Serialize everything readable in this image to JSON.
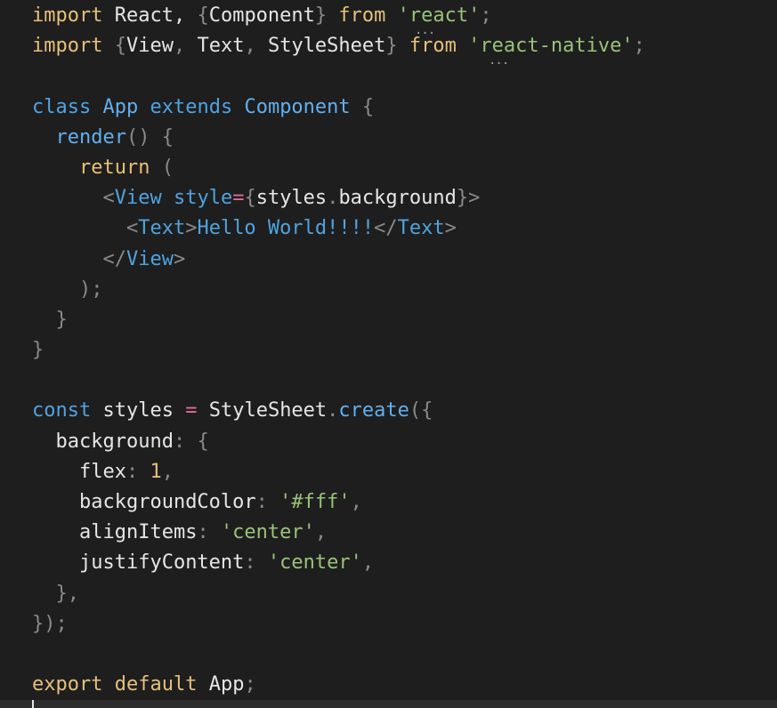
{
  "code_lines": [
    [
      "import",
      " React, ",
      "{",
      "Component",
      "}",
      " from ",
      "'react'",
      ";"
    ],
    [
      "import",
      " ",
      "{",
      "View",
      ", ",
      "Text",
      ", ",
      "StyleSheet",
      "}",
      " from ",
      "'react-native'",
      ";"
    ],
    [],
    [
      "class",
      " ",
      "App",
      " ",
      "extends",
      " ",
      "Component",
      " ",
      "{"
    ],
    [
      "  ",
      "render",
      "()",
      " ",
      "{"
    ],
    [
      "    ",
      "return",
      " ",
      "("
    ],
    [
      "      ",
      "<",
      "View",
      " ",
      "style",
      "=",
      "{",
      "styles",
      ".",
      "background",
      "}",
      ">"
    ],
    [
      "        ",
      "<",
      "Text",
      ">",
      "Hello World!!!!",
      "</",
      "Text",
      ">"
    ],
    [
      "      ",
      "</",
      "View",
      ">"
    ],
    [
      "    ",
      ");"
    ],
    [
      "  ",
      "}"
    ],
    [
      "}"
    ],
    [],
    [
      "const",
      " ",
      "styles",
      " ",
      "=",
      " ",
      "StyleSheet",
      ".",
      "create",
      "({"
    ],
    [
      "  ",
      "background",
      ":",
      " ",
      "{"
    ],
    [
      "    ",
      "flex",
      ":",
      " ",
      "1",
      ","
    ],
    [
      "    ",
      "backgroundColor",
      ":",
      " ",
      "'#fff'",
      ","
    ],
    [
      "    ",
      "alignItems",
      ":",
      " ",
      "'center'",
      ","
    ],
    [
      "    ",
      "justifyContent",
      ":",
      " ",
      "'center'",
      ","
    ],
    [
      "  ",
      "},"
    ],
    [
      "});"
    ],
    [],
    [
      "export",
      " ",
      "default",
      " ",
      "App",
      ";"
    ]
  ],
  "token_types": [
    [
      "kw",
      "id",
      "punc",
      "id",
      "punc",
      "kw",
      "str",
      "punc"
    ],
    [
      "kw",
      "id",
      "punc",
      "id",
      "punc",
      "id",
      "punc",
      "id",
      "punc",
      "kw",
      "str",
      "punc"
    ],
    [],
    [
      "kw2",
      "id",
      "cls",
      "id",
      "kw2",
      "id",
      "cls",
      "id",
      "punc"
    ],
    [
      "id",
      "fn",
      "punc",
      "id",
      "punc"
    ],
    [
      "id",
      "kw",
      "id",
      "punc"
    ],
    [
      "id",
      "punc",
      "tag",
      "id",
      "attr",
      "op",
      "punc",
      "id",
      "punc",
      "prop",
      "punc",
      "punc"
    ],
    [
      "id",
      "punc",
      "tag",
      "punc",
      "text",
      "punc",
      "tag",
      "punc"
    ],
    [
      "id",
      "punc",
      "tag",
      "punc"
    ],
    [
      "id",
      "punc"
    ],
    [
      "id",
      "punc"
    ],
    [
      "punc"
    ],
    [],
    [
      "kw2",
      "id",
      "id",
      "id",
      "op",
      "id",
      "id",
      "punc",
      "fn",
      "punc"
    ],
    [
      "id",
      "prop",
      "punc",
      "id",
      "punc"
    ],
    [
      "id",
      "prop",
      "punc",
      "id",
      "num",
      "punc"
    ],
    [
      "id",
      "prop",
      "punc",
      "id",
      "str",
      "punc"
    ],
    [
      "id",
      "prop",
      "punc",
      "id",
      "str",
      "punc"
    ],
    [
      "id",
      "prop",
      "punc",
      "id",
      "str",
      "punc"
    ],
    [
      "id",
      "punc"
    ],
    [
      "punc"
    ],
    [],
    [
      "kw",
      "id",
      "kw",
      "id",
      "id",
      "punc"
    ]
  ],
  "colors": {
    "background": "#1e1e1e",
    "keyword": "#e5c07b",
    "keyword_blue": "#4fa3e0",
    "string": "#98c379",
    "identifier": "#e6e6e6",
    "punctuation": "#8a8a8a",
    "operator": "#e06c9f"
  },
  "hints": {
    "dots": "..."
  }
}
